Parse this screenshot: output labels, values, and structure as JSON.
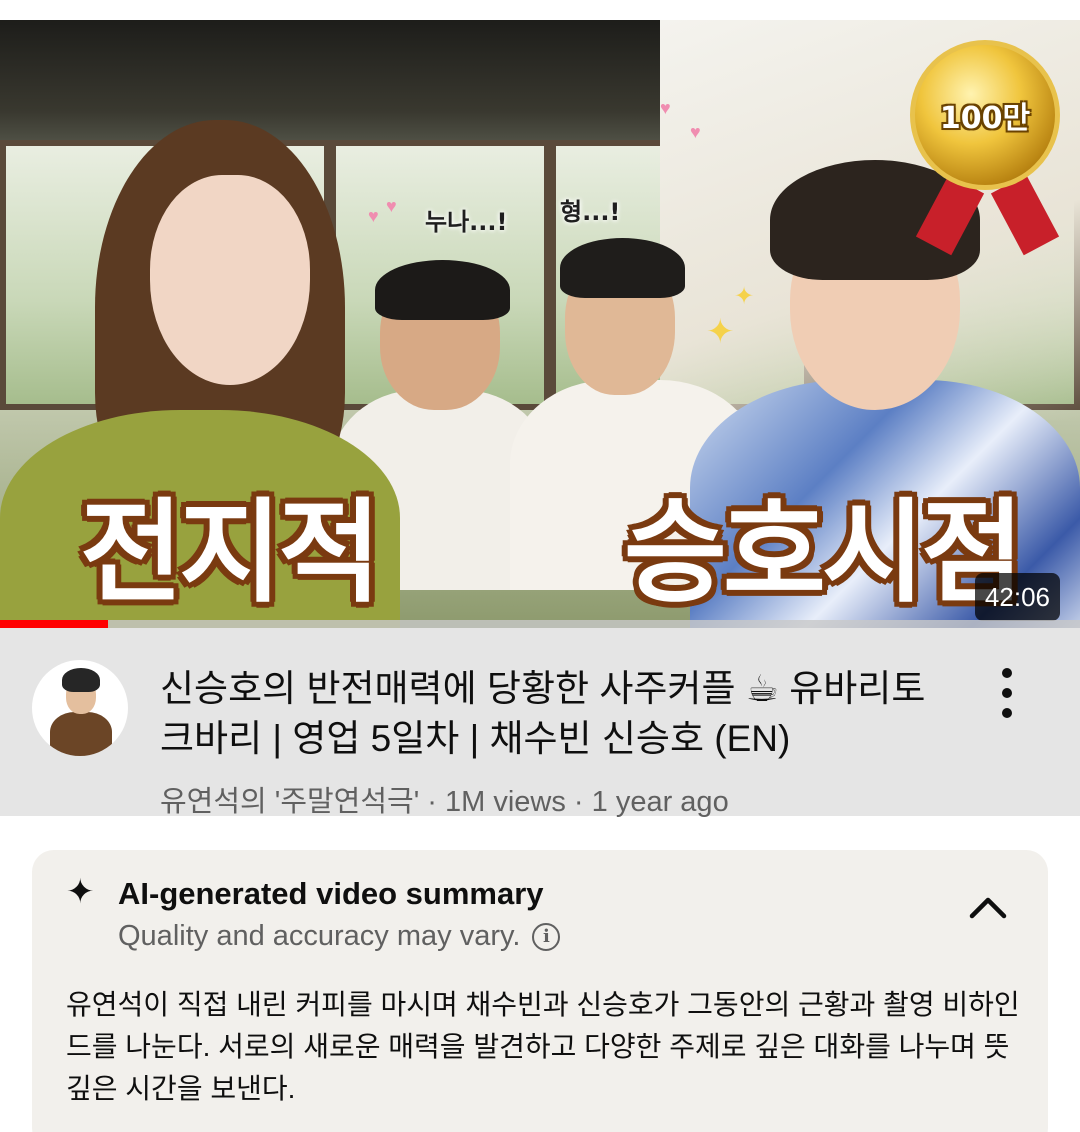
{
  "thumbnail": {
    "speech_1": "누나...!",
    "speech_2": "형...!",
    "medal_text": "100만",
    "overlay_title": [
      "전지적",
      "승호시점"
    ],
    "duration": "42:06",
    "watched_progress": 0.1
  },
  "video": {
    "title": "신승호의 반전매력에 당황한 사주커플 ☕ 유바리토크바리 | 영업 5일차 | 채수빈 신승호 (EN)",
    "meta": "유연석의 '주말연석극' · 1M views · 1 year ago"
  },
  "summary": {
    "title": "AI-generated video summary",
    "subtitle": "Quality and accuracy may vary.",
    "body": "유연석이 직접 내린 커피를 마시며 채수빈과 신승호가 그동안의 근황과 촬영 비하인드를 나눈다. 서로의 새로운 매력을 발견하고 다양한 주제로 깊은 대화를 나누며 뜻깊은 시간을 보낸다."
  },
  "icons": {
    "more": "three-dots-vertical-icon",
    "sparkle": "sparkle-icon",
    "info": "info-icon",
    "collapse": "chevron-up-icon"
  },
  "colors": {
    "progress": "#ff0000",
    "info_bg": "#e5e5e5",
    "summary_bg": "#f2f0ec"
  }
}
